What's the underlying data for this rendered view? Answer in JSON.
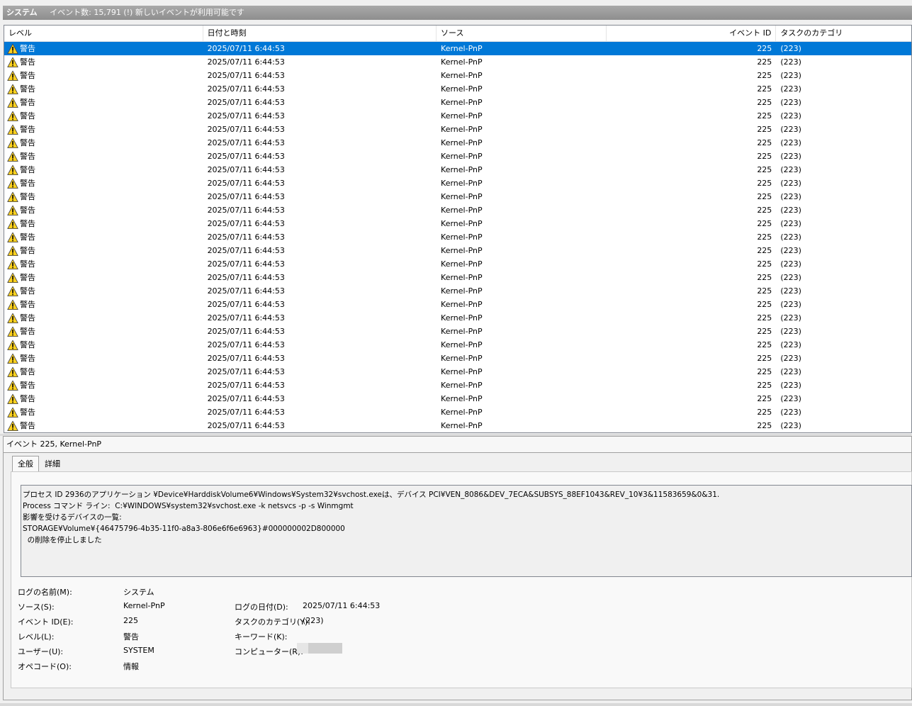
{
  "header": {
    "log_name": "システム",
    "info": "イベント数: 15,791 (!) 新しいイベントが利用可能です"
  },
  "list": {
    "columns": [
      "レベル",
      "日付と時刻",
      "ソース",
      "イベント ID",
      "タスクのカテゴリ"
    ],
    "rows": [
      {
        "level": "警告",
        "date": "2025/07/11 6:44:53",
        "source": "Kernel-PnP",
        "id": "225",
        "task": "(223)",
        "selected": true
      },
      {
        "level": "警告",
        "date": "2025/07/11 6:44:53",
        "source": "Kernel-PnP",
        "id": "225",
        "task": "(223)"
      },
      {
        "level": "警告",
        "date": "2025/07/11 6:44:53",
        "source": "Kernel-PnP",
        "id": "225",
        "task": "(223)"
      },
      {
        "level": "警告",
        "date": "2025/07/11 6:44:53",
        "source": "Kernel-PnP",
        "id": "225",
        "task": "(223)"
      },
      {
        "level": "警告",
        "date": "2025/07/11 6:44:53",
        "source": "Kernel-PnP",
        "id": "225",
        "task": "(223)"
      },
      {
        "level": "警告",
        "date": "2025/07/11 6:44:53",
        "source": "Kernel-PnP",
        "id": "225",
        "task": "(223)"
      },
      {
        "level": "警告",
        "date": "2025/07/11 6:44:53",
        "source": "Kernel-PnP",
        "id": "225",
        "task": "(223)"
      },
      {
        "level": "警告",
        "date": "2025/07/11 6:44:53",
        "source": "Kernel-PnP",
        "id": "225",
        "task": "(223)"
      },
      {
        "level": "警告",
        "date": "2025/07/11 6:44:53",
        "source": "Kernel-PnP",
        "id": "225",
        "task": "(223)"
      },
      {
        "level": "警告",
        "date": "2025/07/11 6:44:53",
        "source": "Kernel-PnP",
        "id": "225",
        "task": "(223)"
      },
      {
        "level": "警告",
        "date": "2025/07/11 6:44:53",
        "source": "Kernel-PnP",
        "id": "225",
        "task": "(223)"
      },
      {
        "level": "警告",
        "date": "2025/07/11 6:44:53",
        "source": "Kernel-PnP",
        "id": "225",
        "task": "(223)"
      },
      {
        "level": "警告",
        "date": "2025/07/11 6:44:53",
        "source": "Kernel-PnP",
        "id": "225",
        "task": "(223)"
      },
      {
        "level": "警告",
        "date": "2025/07/11 6:44:53",
        "source": "Kernel-PnP",
        "id": "225",
        "task": "(223)"
      },
      {
        "level": "警告",
        "date": "2025/07/11 6:44:53",
        "source": "Kernel-PnP",
        "id": "225",
        "task": "(223)"
      },
      {
        "level": "警告",
        "date": "2025/07/11 6:44:53",
        "source": "Kernel-PnP",
        "id": "225",
        "task": "(223)"
      },
      {
        "level": "警告",
        "date": "2025/07/11 6:44:53",
        "source": "Kernel-PnP",
        "id": "225",
        "task": "(223)"
      },
      {
        "level": "警告",
        "date": "2025/07/11 6:44:53",
        "source": "Kernel-PnP",
        "id": "225",
        "task": "(223)"
      },
      {
        "level": "警告",
        "date": "2025/07/11 6:44:53",
        "source": "Kernel-PnP",
        "id": "225",
        "task": "(223)"
      },
      {
        "level": "警告",
        "date": "2025/07/11 6:44:53",
        "source": "Kernel-PnP",
        "id": "225",
        "task": "(223)"
      },
      {
        "level": "警告",
        "date": "2025/07/11 6:44:53",
        "source": "Kernel-PnP",
        "id": "225",
        "task": "(223)"
      },
      {
        "level": "警告",
        "date": "2025/07/11 6:44:53",
        "source": "Kernel-PnP",
        "id": "225",
        "task": "(223)"
      },
      {
        "level": "警告",
        "date": "2025/07/11 6:44:53",
        "source": "Kernel-PnP",
        "id": "225",
        "task": "(223)"
      },
      {
        "level": "警告",
        "date": "2025/07/11 6:44:53",
        "source": "Kernel-PnP",
        "id": "225",
        "task": "(223)"
      },
      {
        "level": "警告",
        "date": "2025/07/11 6:44:53",
        "source": "Kernel-PnP",
        "id": "225",
        "task": "(223)"
      },
      {
        "level": "警告",
        "date": "2025/07/11 6:44:53",
        "source": "Kernel-PnP",
        "id": "225",
        "task": "(223)"
      },
      {
        "level": "警告",
        "date": "2025/07/11 6:44:53",
        "source": "Kernel-PnP",
        "id": "225",
        "task": "(223)"
      },
      {
        "level": "警告",
        "date": "2025/07/11 6:44:53",
        "source": "Kernel-PnP",
        "id": "225",
        "task": "(223)"
      },
      {
        "level": "警告",
        "date": "2025/07/11 6:44:53",
        "source": "Kernel-PnP",
        "id": "225",
        "task": "(223)"
      }
    ],
    "row_icon": "warning-triangle-icon"
  },
  "detail": {
    "title": "イベント 225, Kernel-PnP",
    "tabs": [
      "全般",
      "詳細"
    ],
    "message_lines": [
      "プロセス ID 2936のアプリケーション ¥Device¥HarddiskVolume6¥Windows¥System32¥svchost.exeは、デバイス PCI¥VEN_8086&DEV_7ECA&SUBSYS_88EF1043&REV_10¥3&11583659&0&31.",
      "Process コマンド ライン:  C:¥WINDOWS¥system32¥svchost.exe -k netsvcs -p -s Winmgmt",
      "影響を受けるデバイスの一覧:",
      "STORAGE¥Volume¥{46475796-4b35-11f0-a8a3-806e6f6e6963}#000000002D800000",
      "  の削除を停止しました"
    ],
    "props": {
      "log_name_label": "ログの名前(M):",
      "log_name_value": "システム",
      "source_label": "ソース(S):",
      "source_value": "Kernel-PnP",
      "event_id_label": "イベント ID(E):",
      "event_id_value": "225",
      "level_label": "レベル(L):",
      "level_value": "警告",
      "user_label": "ユーザー(U):",
      "user_value": "SYSTEM",
      "opcode_label": "オペコード(O):",
      "opcode_value": "情報",
      "logged_label": "ログの日付(D):",
      "logged_value": "2025/07/11 6:44:53",
      "task_label": "タスクのカテゴリ(Y):",
      "task_value": "(223)",
      "keywords_label": "キーワード(K):",
      "keywords_value": "",
      "computer_label": "コンピューター(R):"
    }
  },
  "colors": {
    "selection": "#0078d7",
    "warning_fill": "#ffd21f"
  }
}
